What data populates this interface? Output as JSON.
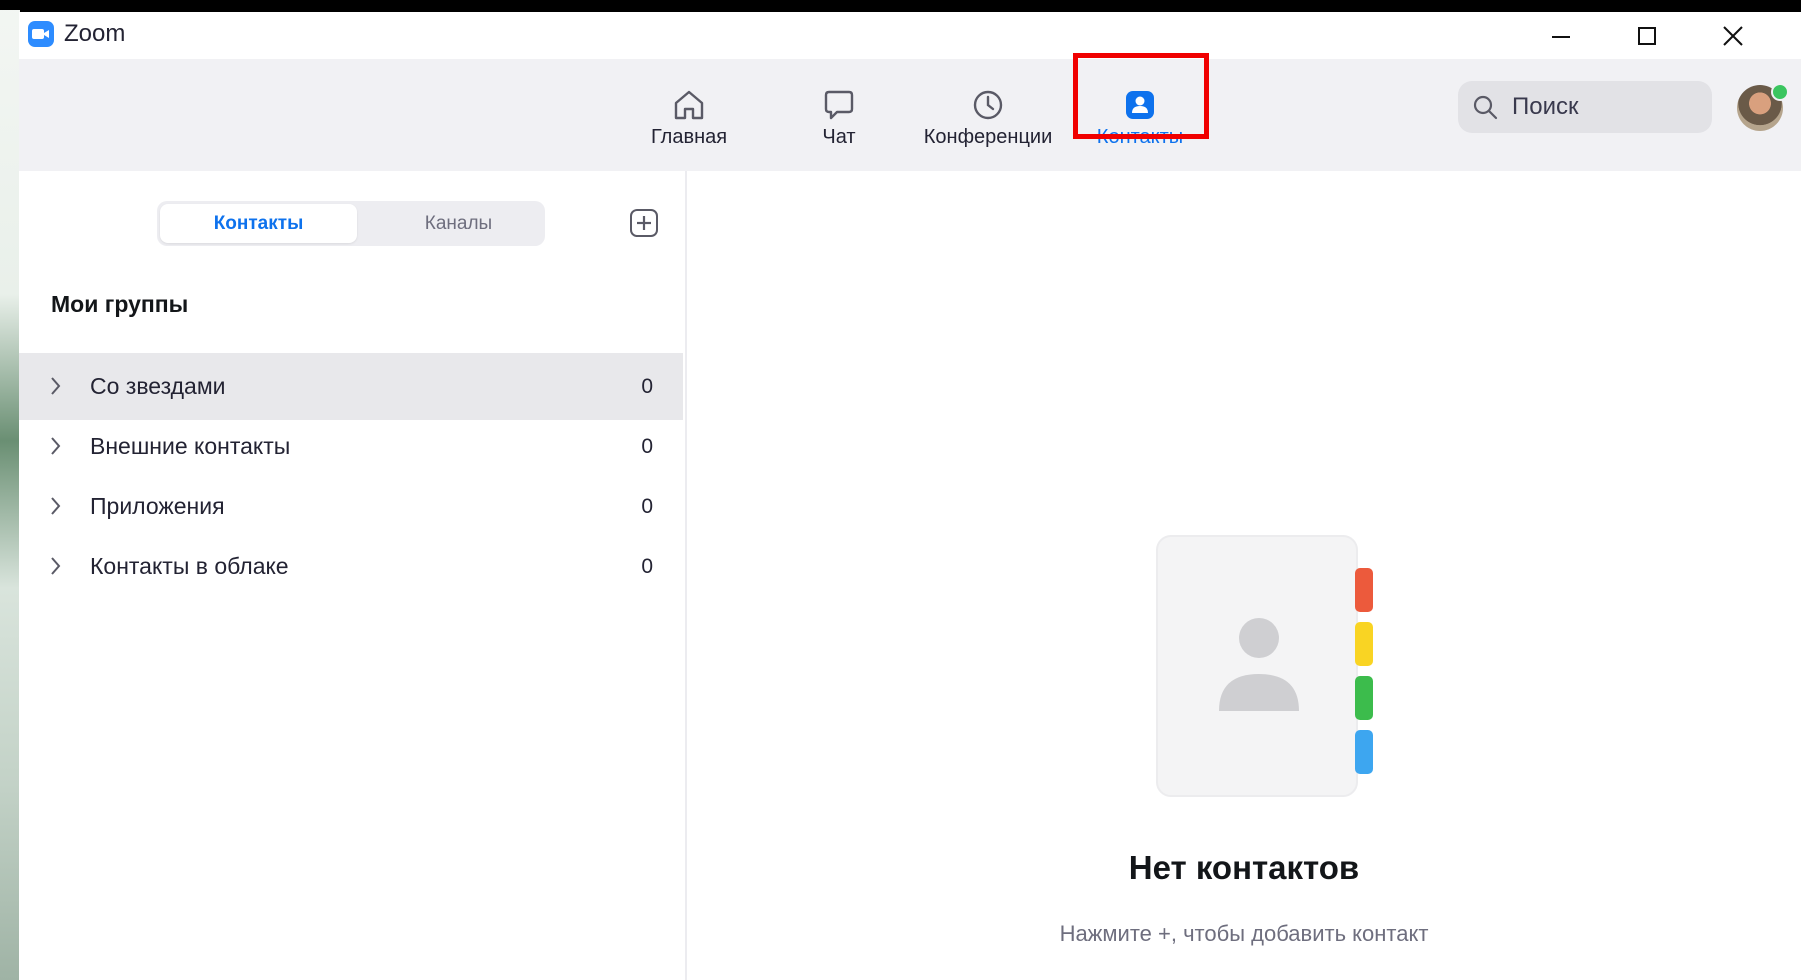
{
  "window": {
    "title": "Zoom",
    "controls": {
      "minimize": "minimize-icon",
      "maximize": "maximize-icon",
      "close": "close-icon"
    }
  },
  "topnav": {
    "tabs": [
      {
        "label": "Главная",
        "icon": "home-icon",
        "active": false
      },
      {
        "label": "Чат",
        "icon": "chat-bubble-icon",
        "active": false
      },
      {
        "label": "Конференции",
        "icon": "clock-icon",
        "active": false
      },
      {
        "label": "Контакты",
        "icon": "contact-icon",
        "active": true
      }
    ],
    "search": {
      "placeholder": "Поиск",
      "icon": "search-icon"
    },
    "profile": {
      "status": "online",
      "status_color": "#3bc55f"
    }
  },
  "colors": {
    "accent": "#0e72ed",
    "highlight_box": "#f00000",
    "nav_background": "#f1f1f4"
  },
  "contacts_panel": {
    "segments": [
      {
        "label": "Контакты",
        "active": true
      },
      {
        "label": "Каналы",
        "active": false
      }
    ],
    "add_button_icon": "plus-square-icon",
    "groups_title": "Мои группы",
    "groups": [
      {
        "label": "Со звездами",
        "count": "0",
        "selected": true
      },
      {
        "label": "Внешние контакты",
        "count": "0",
        "selected": false
      },
      {
        "label": "Приложения",
        "count": "0",
        "selected": false
      },
      {
        "label": "Контакты в облаке",
        "count": "0",
        "selected": false
      }
    ]
  },
  "empty_state": {
    "illustration": "address-book-icon",
    "title": "Нет контактов",
    "subtitle": "Нажмите +, чтобы добавить контакт"
  }
}
